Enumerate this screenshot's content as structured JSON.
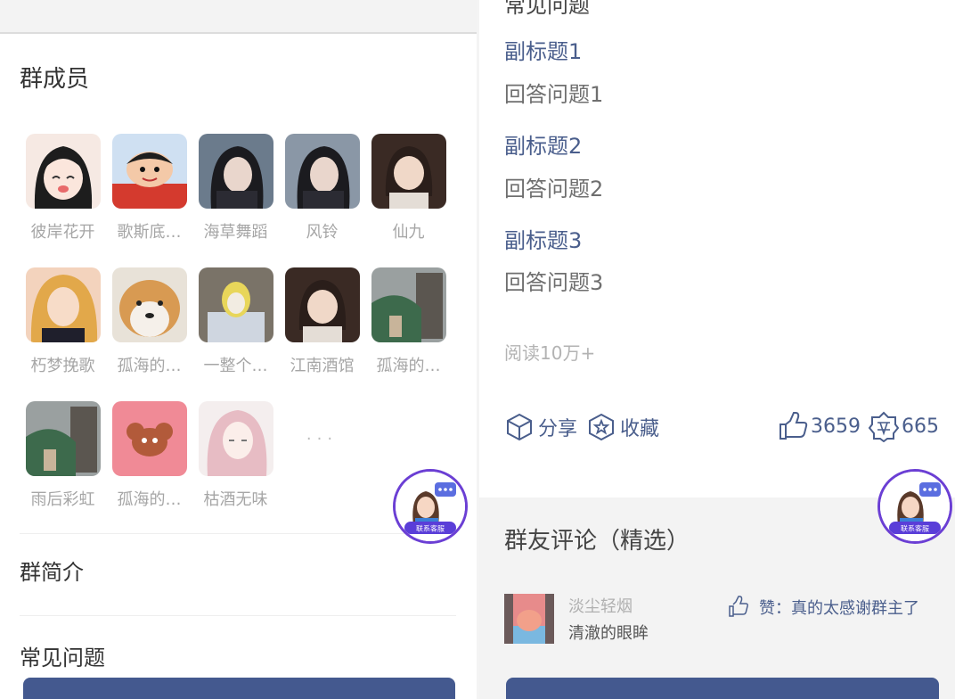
{
  "left": {
    "members_title": "群成员",
    "members": [
      [
        "彼岸花开",
        "歌斯底…",
        "海草舞蹈",
        "风铃",
        "仙九"
      ],
      [
        "朽梦挽歌",
        "孤海的…",
        "一整个…",
        "江南酒馆",
        "孤海的…"
      ],
      [
        "雨后彩虹",
        "孤海的…",
        "枯酒无味"
      ]
    ],
    "more": "···",
    "intro_title": "群简介",
    "faq_title": "常见问题"
  },
  "right": {
    "faq_title": "常见问题",
    "faqs": [
      {
        "q": "副标题1",
        "a": "回答问题1"
      },
      {
        "q": "副标题2",
        "a": "回答问题2"
      },
      {
        "q": "副标题3",
        "a": "回答问题3"
      }
    ],
    "read_count": "阅读10万+",
    "share_label": "分享",
    "collect_label": "收藏",
    "like_count": "3659",
    "reward_count": "665",
    "comments_title": "群友评论（精选）",
    "comment": {
      "user": "淡尘轻烟",
      "text": "清澈的眼眸",
      "like_text": "赞：真的太感谢群主了"
    }
  },
  "support_label": "联系客服",
  "colors": {
    "accent": "#4a5e8c",
    "button": "#44598f",
    "muted": "#a6a6a6",
    "support_ring": "#6b3fd4"
  }
}
